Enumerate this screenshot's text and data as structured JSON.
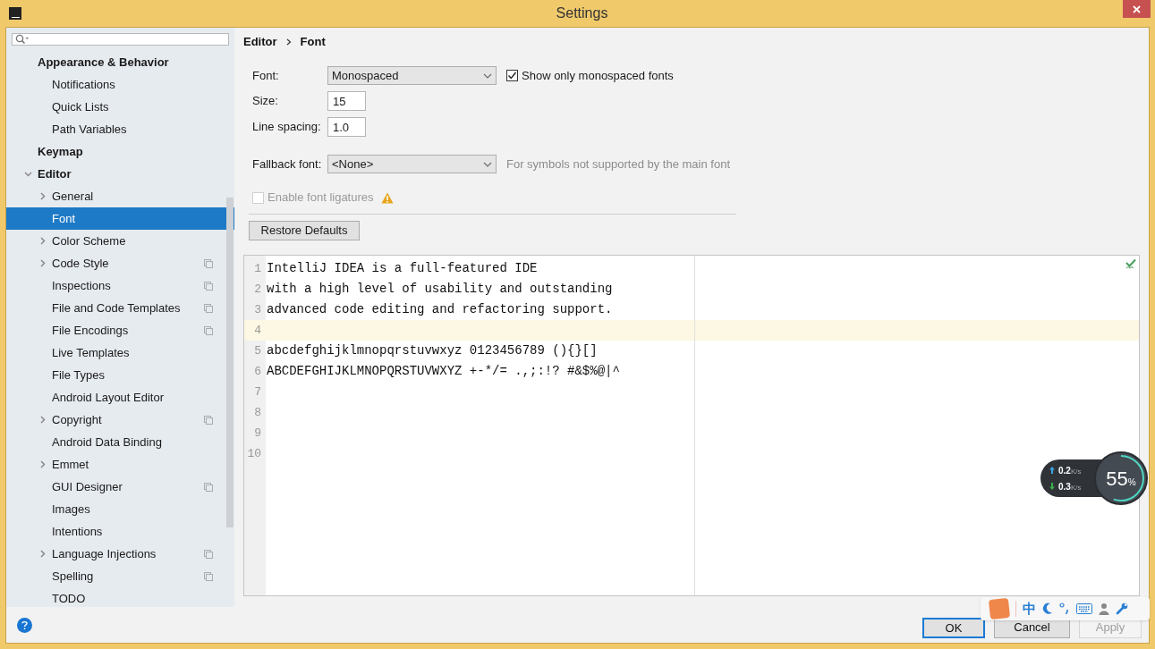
{
  "window": {
    "title": "Settings"
  },
  "sidebar": {
    "items": [
      {
        "label": "Appearance & Behavior",
        "selected": false,
        "project_level": false,
        "children": [
          {
            "label": "Notifications",
            "selected": false,
            "project_level": false
          },
          {
            "label": "Quick Lists",
            "selected": false,
            "project_level": false
          },
          {
            "label": "Path Variables",
            "selected": false,
            "project_level": false
          }
        ]
      },
      {
        "label": "Keymap",
        "selected": false,
        "project_level": false
      },
      {
        "label": "Editor",
        "selected": false,
        "project_level": false,
        "expanded": true,
        "children": [
          {
            "label": "General",
            "selected": false,
            "project_level": false,
            "expanded": false
          },
          {
            "label": "Font",
            "selected": true,
            "project_level": false
          },
          {
            "label": "Color Scheme",
            "selected": false,
            "project_level": false,
            "expanded": false
          },
          {
            "label": "Code Style",
            "selected": false,
            "project_level": true,
            "expanded": false
          },
          {
            "label": "Inspections",
            "selected": false,
            "project_level": true
          },
          {
            "label": "File and Code Templates",
            "selected": false,
            "project_level": true
          },
          {
            "label": "File Encodings",
            "selected": false,
            "project_level": true
          },
          {
            "label": "Live Templates",
            "selected": false,
            "project_level": false
          },
          {
            "label": "File Types",
            "selected": false,
            "project_level": false
          },
          {
            "label": "Android Layout Editor",
            "selected": false,
            "project_level": false
          },
          {
            "label": "Copyright",
            "selected": false,
            "project_level": true,
            "expanded": false
          },
          {
            "label": "Android Data Binding",
            "selected": false,
            "project_level": false
          },
          {
            "label": "Emmet",
            "selected": false,
            "project_level": false,
            "expanded": false
          },
          {
            "label": "GUI Designer",
            "selected": false,
            "project_level": true
          },
          {
            "label": "Images",
            "selected": false,
            "project_level": false
          },
          {
            "label": "Intentions",
            "selected": false,
            "project_level": false
          },
          {
            "label": "Language Injections",
            "selected": false,
            "project_level": true,
            "expanded": false
          },
          {
            "label": "Spelling",
            "selected": false,
            "project_level": true
          },
          {
            "label": "TODO",
            "selected": false,
            "project_level": false
          }
        ]
      }
    ]
  },
  "breadcrumb": [
    "Editor",
    "Font"
  ],
  "form": {
    "font": {
      "label": "Font:",
      "value": "Monospaced"
    },
    "monospaced_only": {
      "label": "Show only monospaced fonts",
      "checked": true
    },
    "size": {
      "label": "Size:",
      "value": "15"
    },
    "line_spacing": {
      "label": "Line spacing:",
      "value": "1.0"
    },
    "fallback": {
      "label": "Fallback font:",
      "value": "<None>",
      "hint": "For symbols not supported by the main font"
    },
    "ligatures": {
      "label": "Enable font ligatures",
      "checked": false,
      "disabled": true
    }
  },
  "restore_button": "Restore Defaults",
  "preview": {
    "lines": [
      {
        "number": "1",
        "text": "IntelliJ IDEA is a full-featured IDE",
        "current": false
      },
      {
        "number": "2",
        "text": "with a high level of usability and outstanding",
        "current": false
      },
      {
        "number": "3",
        "text": "advanced code editing and refactoring support.",
        "current": false
      },
      {
        "number": "4",
        "current": true
      },
      {
        "number": "5",
        "text": "abcdefghijklmnopqrstuvwxyz 0123456789 (){}[]",
        "current": false
      },
      {
        "number": "6",
        "text": "ABCDEFGHIJKLMNOPQRSTUVWXYZ +-*/= .,;:!? #&$%@|^",
        "current": false
      },
      {
        "number": "7",
        "current": false
      },
      {
        "number": "8",
        "current": false
      },
      {
        "number": "9",
        "current": false
      },
      {
        "number": "10",
        "current": false
      }
    ]
  },
  "buttons": [
    {
      "label": "OK",
      "focused": true,
      "disabled": false
    },
    {
      "label": "Cancel",
      "focused": false,
      "disabled": false
    },
    {
      "label": "Apply",
      "focused": false,
      "disabled": true
    }
  ],
  "network_widget": {
    "upload": "0.2",
    "upload_unit": "K/s",
    "download": "0.3",
    "download_unit": "K/s",
    "percent": "55",
    "percent_sign": "%"
  },
  "ime_toolbar": {
    "mode": "中"
  }
}
